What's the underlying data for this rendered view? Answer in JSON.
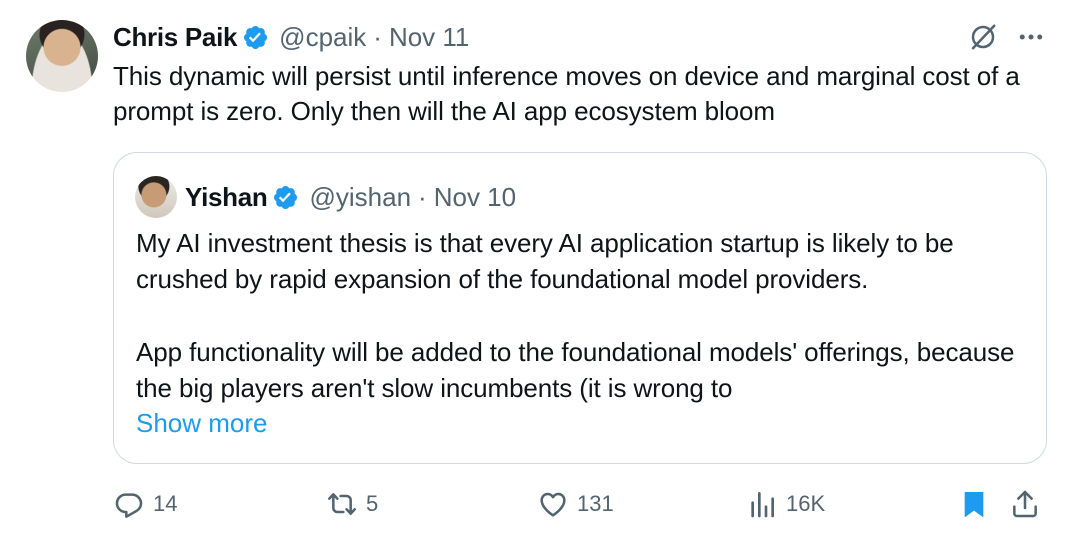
{
  "tweet": {
    "author_name": "Chris Paik",
    "author_handle": "@cpaik",
    "separator": "·",
    "date": "Nov 11",
    "text": "This dynamic will persist until inference moves on device and marginal cost of a prompt is zero. Only then will the AI app ecosystem bloom"
  },
  "quote": {
    "author_name": "Yishan",
    "author_handle": "@yishan",
    "separator": "·",
    "date": "Nov 10",
    "paragraph_1": "My AI investment thesis is that every AI application startup is likely to be crushed by rapid expansion of the foundational model providers.",
    "paragraph_2": "App functionality will be added to the foundational models' offerings, because the big players aren't slow incumbents (it is wrong to",
    "show_more": "Show more"
  },
  "actions": {
    "replies": "14",
    "reposts": "5",
    "likes": "131",
    "views": "16K"
  },
  "icons": {
    "verified": "verified-badge-icon",
    "grok": "grok-icon",
    "more": "more-icon",
    "reply": "reply-icon",
    "repost": "repost-icon",
    "like": "heart-icon",
    "views": "views-icon",
    "bookmark": "bookmark-icon",
    "share": "share-icon"
  },
  "colors": {
    "text": "#0f1419",
    "secondary": "#536471",
    "link": "#1d9bf0",
    "verified": "#1d9bf0",
    "border": "#cfd9de"
  }
}
